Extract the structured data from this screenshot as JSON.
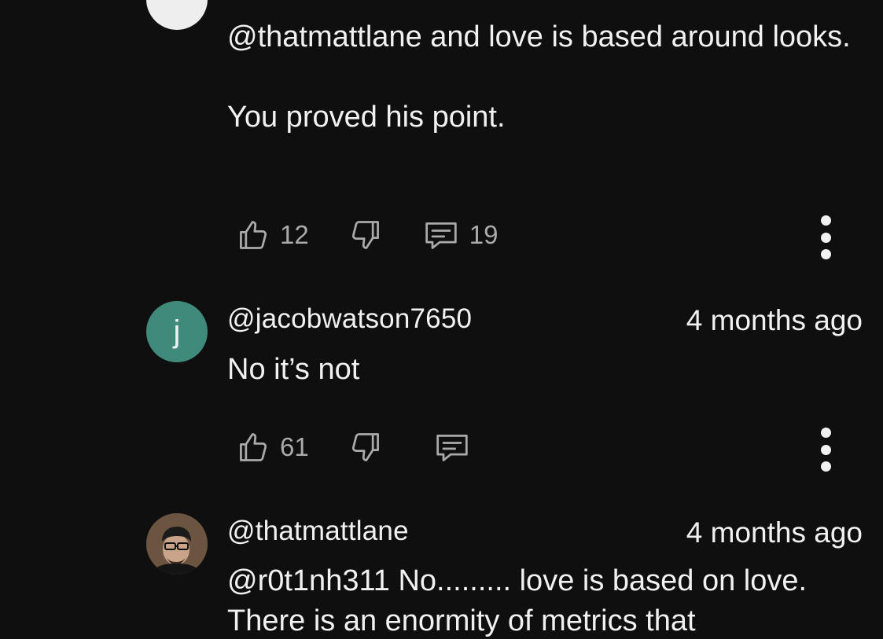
{
  "comments": [
    {
      "avatar": {
        "type": "blank",
        "color": "#eeeeee"
      },
      "body": "@thatmattlane and love is based around looks.\n\nYou proved his point.",
      "likes": "12",
      "replies": "19"
    },
    {
      "avatar": {
        "type": "letter",
        "letter": "j",
        "color": "#3f8a7a"
      },
      "handle": "@jacobwatson7650",
      "time": "4 months ago",
      "body": "No it’s not",
      "likes": "61",
      "replies": ""
    },
    {
      "avatar": {
        "type": "photo",
        "color": "#5a4634"
      },
      "handle": "@thatmattlane",
      "time": "4 months ago",
      "body": "@r0t1nh311 No......... love is based on love.\nThere is an enormity of metrics that"
    }
  ],
  "icons": {
    "like": "thumbs-up-icon",
    "dislike": "thumbs-down-icon",
    "reply": "reply-comment-icon",
    "more": "more-vertical-icon"
  }
}
